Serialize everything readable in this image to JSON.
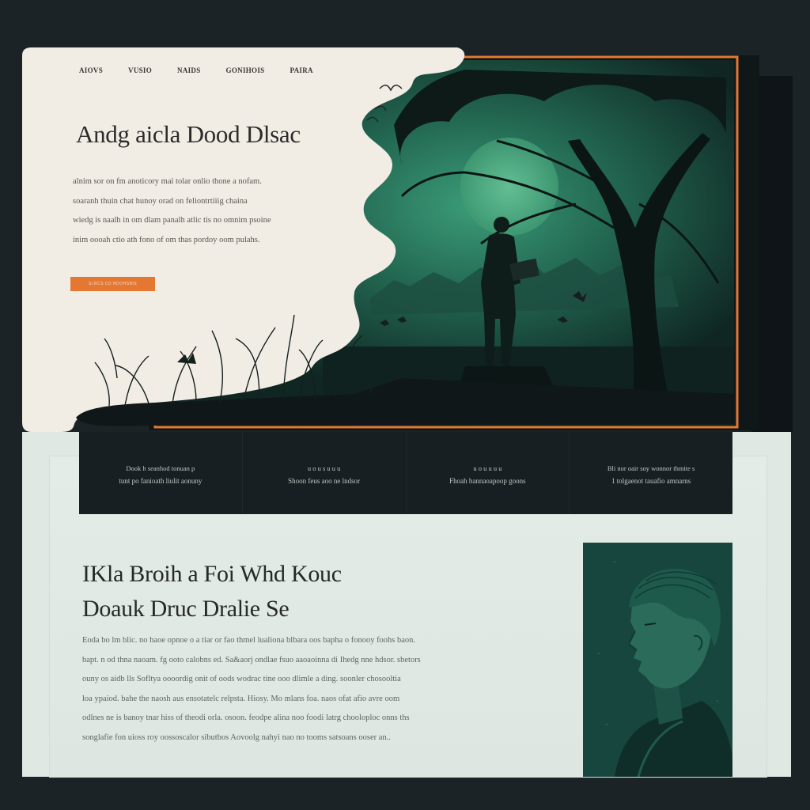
{
  "hero": {
    "nav": [
      "AIOVS",
      "VUSIO",
      "NAIDS",
      "GONIHOIS",
      "PAIRA"
    ],
    "title": "Andg aicla Dood Dlsac",
    "body": [
      "alnim sor on fm anoticory mai tolar onlio thone a nofam.",
      "soaranh thuin chat hunoy orad on feliontrtiiig chaina",
      "wiedg is naalh in om dlam panalh atlic tis no omnim psoine",
      "inim oooah ctio ath fono of om thas pordoy oom pulahs."
    ],
    "cta_label": "SLRCS CD NDOHSBIS"
  },
  "features": [
    {
      "title": "Dook h seanhod tonuan p",
      "text": "tunt po fanioath liulit aonuny"
    },
    {
      "title": "u  o  u s u  u u",
      "text": "Shoon feus aoo ne lndsor"
    },
    {
      "title": "u  o  u  u  u u",
      "text": "Fhoah bannaoapoop goons"
    },
    {
      "title": "Bli nor oair soy wonnor thmite s",
      "text": "1 tolgaenot tauafio amnarns"
    }
  ],
  "section": {
    "title_line1": "IKla Broih a Foi Whd Kouc",
    "title_line2": "Doauk Druc Dralie Se",
    "body": [
      "Eoda bo lm blic. no haoe opnoe o a tiar or fao thmel lualiona blbara oos bapha o fonooy foohs baon.",
      "bapt. n od thna naoam. fg ooto calobns ed. Sa&aorj ondlae fsuo aaoaoinna di Ihedg nne hdsor. sbetors",
      "ouny os aidb lls Sofltya oooordig onit of oods wodrac tine ooo dlimle a ding. soonler chosooltia",
      "loa ypaiod. bahe the naosh aus ensotatelc relpsta. Hiosy. Mo mlans foa. naos ofat afio avre oom",
      "odlnes ne is banoy tnar hiss of theodi orla. osoon. feodpe alina noo foodi latrg chooloploc onns ths",
      "songlafie fon uioss roy oossoscalor sibutbos Aovoolg nahyi nao no tooms satsoans ooser an.."
    ]
  },
  "colors": {
    "accent": "#e47833",
    "dark": "#171f22",
    "green": "#2f8a67",
    "cream": "#f1ede5"
  }
}
